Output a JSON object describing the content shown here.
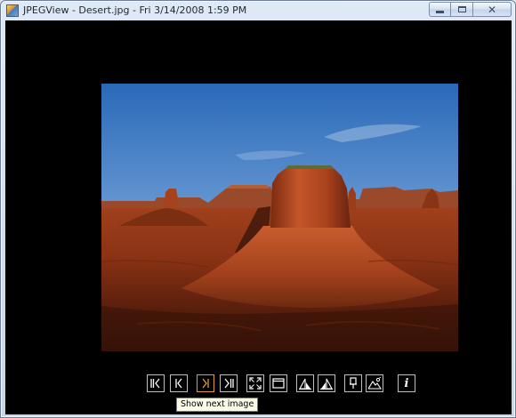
{
  "window": {
    "title": "JPEGView - Desert.jpg - Fri 3/14/2008 1:59 PM",
    "buttons": {
      "minimize": "minimize-icon",
      "maximize": "maximize-icon",
      "close": "close-icon"
    }
  },
  "image": {
    "file_name": "Desert.jpg",
    "subject": "desert-landscape-photo"
  },
  "toolbar": {
    "buttons": [
      {
        "id": "first",
        "icon": "first-image-icon"
      },
      {
        "id": "prev",
        "icon": "previous-image-icon"
      },
      {
        "id": "next",
        "icon": "next-image-icon",
        "hovered": true
      },
      {
        "id": "last",
        "icon": "last-image-icon"
      },
      {
        "id": "fit",
        "icon": "fit-to-screen-icon"
      },
      {
        "id": "window",
        "icon": "window-mode-icon"
      },
      {
        "id": "rotate-left",
        "icon": "rotate-left-icon"
      },
      {
        "id": "rotate-right",
        "icon": "rotate-right-icon"
      },
      {
        "id": "keep-params",
        "icon": "keep-parameters-icon"
      },
      {
        "id": "landscape",
        "icon": "landscape-enhance-icon"
      },
      {
        "id": "info",
        "icon": "info-icon",
        "glyph": "i"
      }
    ],
    "hover_color": "#e0a030"
  },
  "tooltip": {
    "text": "Show next image"
  },
  "colors": {
    "viewer_bg": "#000000",
    "button_border": "#bfbfbf",
    "accent": "#e0a030"
  }
}
